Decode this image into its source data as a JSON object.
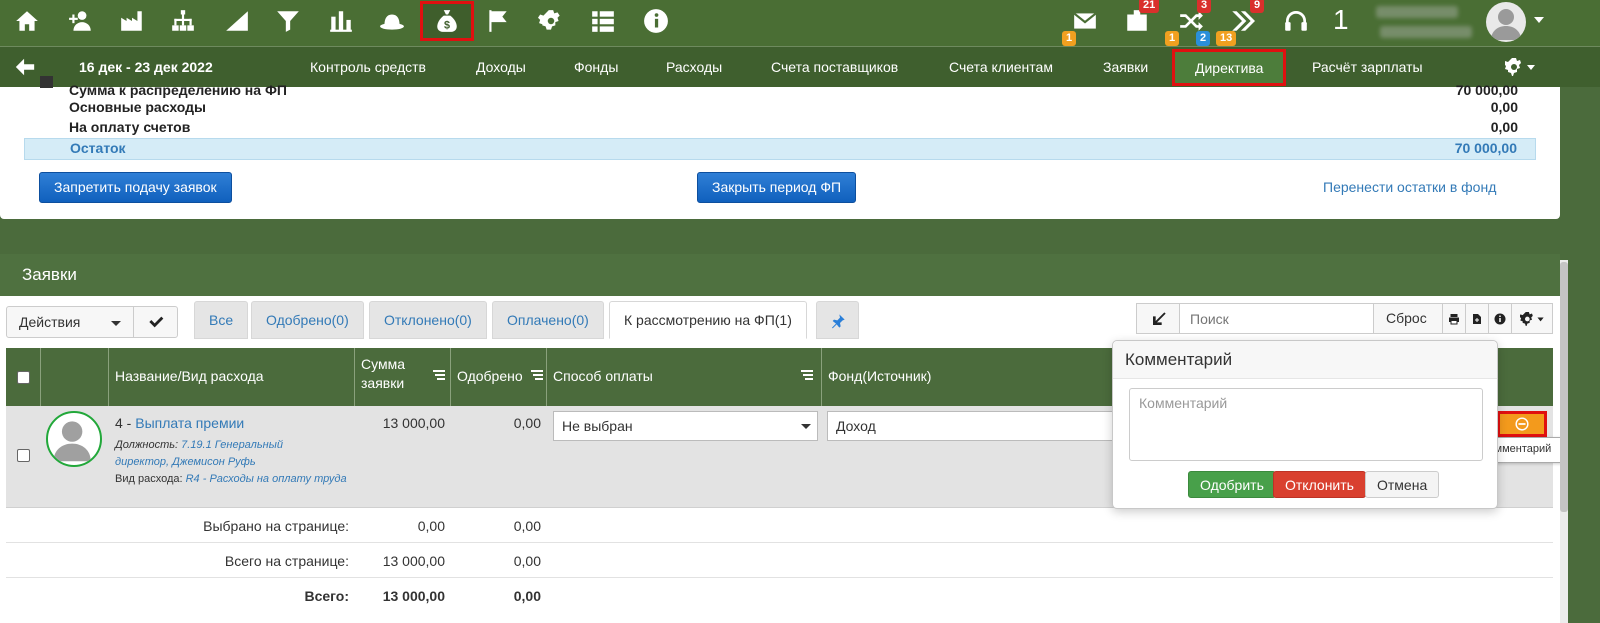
{
  "topbar": {
    "icons": [
      "home-icon",
      "user-plus-icon",
      "factory-icon",
      "org-chart-icon",
      "growth-icon",
      "filter-icon",
      "bar-chart-icon",
      "hat-icon",
      "money-bag-icon",
      "flag-icon",
      "gear-icon",
      "list-icon",
      "info-icon"
    ],
    "active_icon": "money-bag-icon",
    "mail_badge": "1",
    "bag_badge": "21",
    "shuffle_badge_red": "3",
    "shuffle_badge_orange": "1",
    "shuffle_badge_blue": "2",
    "shuffle_badge_orange2": "13",
    "forward_badge": "9",
    "counter": "1"
  },
  "navbar": {
    "period": "16 дек - 23 дек 2022",
    "items": [
      "Контроль средств",
      "Доходы",
      "Фонды",
      "Расходы",
      "Счета поставщиков",
      "Счета клиентам",
      "Заявки",
      "Директива",
      "Расчёт зарплаты"
    ],
    "active": "Директива"
  },
  "funds": {
    "rows": [
      {
        "label": "Сумма к распределению на ФП",
        "value": "70 000,00"
      },
      {
        "label": "Основные расходы",
        "value": "0,00"
      },
      {
        "label": "На оплату счетов",
        "value": "0,00"
      },
      {
        "label": "Остаток",
        "value": "70 000,00"
      }
    ],
    "btn_forbid": "Запретить подачу заявок",
    "btn_close": "Закрыть период ФП",
    "link_transfer": "Перенести остатки в фонд"
  },
  "requests": {
    "title": "Заявки",
    "actions_label": "Действия",
    "tabs": [
      "Все",
      "Одобрено(0)",
      "Отклонено(0)",
      "Оплачено(0)",
      "К рассмотрению на ФП(1)"
    ],
    "active_tab": "К рассмотрению на ФП(1)",
    "search_placeholder": "Поиск",
    "reset_label": "Сброс",
    "columns": {
      "name": "Название/Вид расхода",
      "sum": "Сумма заявки",
      "approved": "Одобрено",
      "payment": "Способ оплаты",
      "fund": "Фонд(Источник)"
    },
    "row": {
      "number": "4 -",
      "title": "Выплата премии",
      "position_label": "Должность:",
      "position_value": "7.19.1 Генеральный директор, Джемисон Руфь",
      "expense_label": "Вид расхода:",
      "expense_value": "R4 - Расходы на оплату труда",
      "sum": "13 000,00",
      "approved": "0,00",
      "payment": "Не выбран",
      "fund": "Доход"
    },
    "summary": [
      {
        "label": "Выбрано на странице:",
        "sum": "0,00",
        "approved": "0,00"
      },
      {
        "label": "Всего на странице:",
        "sum": "13 000,00",
        "approved": "0,00"
      },
      {
        "label": "Всего:",
        "sum": "13 000,00",
        "approved": "0,00"
      }
    ]
  },
  "popover": {
    "title": "Комментарий",
    "placeholder": "Комментарий",
    "approve": "Одобрить",
    "reject": "Отклонить",
    "cancel": "Отмена"
  },
  "tooltip": "Комментарий",
  "colors": {
    "topbar": "#4a6e34",
    "navbar": "#3f5f2e",
    "highlight": "#e01010",
    "link": "#337ab7"
  }
}
